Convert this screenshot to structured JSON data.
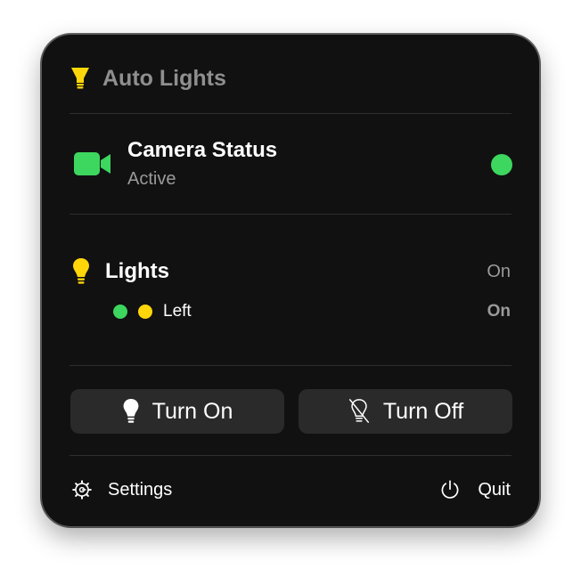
{
  "header": {
    "title": "Auto Lights",
    "icon": "bulb-icon"
  },
  "camera": {
    "icon": "video-camera-icon",
    "title": "Camera Status",
    "status": "Active",
    "indicator_color": "#3dd65f"
  },
  "lights": {
    "icon": "lightbulb-icon",
    "title": "Lights",
    "status": "On",
    "items": [
      {
        "label": "Left",
        "status": "On",
        "dots": [
          "#3dd65f",
          "#ffd60a"
        ]
      }
    ]
  },
  "actions": {
    "turn_on_label": "Turn On",
    "turn_on_icon": "lightbulb-icon",
    "turn_off_label": "Turn Off",
    "turn_off_icon": "lightbulb-slash-icon"
  },
  "footer": {
    "settings_label": "Settings",
    "settings_icon": "gear-icon",
    "quit_label": "Quit",
    "quit_icon": "power-icon"
  },
  "colors": {
    "background": "#111111",
    "accent_green": "#3dd65f",
    "accent_yellow": "#ffd60a",
    "button_bg": "#2a2a2a",
    "muted_text": "#9a9a9a"
  }
}
